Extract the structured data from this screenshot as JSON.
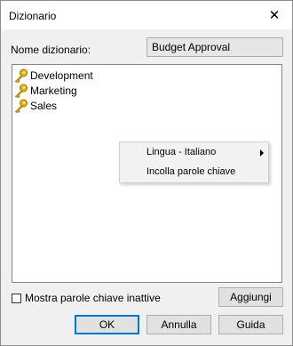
{
  "window": {
    "title": "Dizionario"
  },
  "name_label": "Nome dizionario:",
  "name_value": "Budget Approval",
  "tree": {
    "items": [
      {
        "label": "Development",
        "icon": "key-icon"
      },
      {
        "label": "Marketing",
        "icon": "key-icon"
      },
      {
        "label": "Sales",
        "icon": "key-icon"
      }
    ]
  },
  "context_menu": {
    "items": [
      {
        "label": "Lingua - Italiano",
        "submenu": true
      },
      {
        "label": "Incolla parole chiave",
        "submenu": false
      }
    ]
  },
  "checkbox": {
    "label": "Mostra parole chiave inattive",
    "checked": false
  },
  "buttons": {
    "add": "Aggiungi",
    "ok": "OK",
    "cancel": "Annulla",
    "help": "Guida"
  },
  "colors": {
    "accent": "#0078d7",
    "key_icon": "#d9a300"
  }
}
